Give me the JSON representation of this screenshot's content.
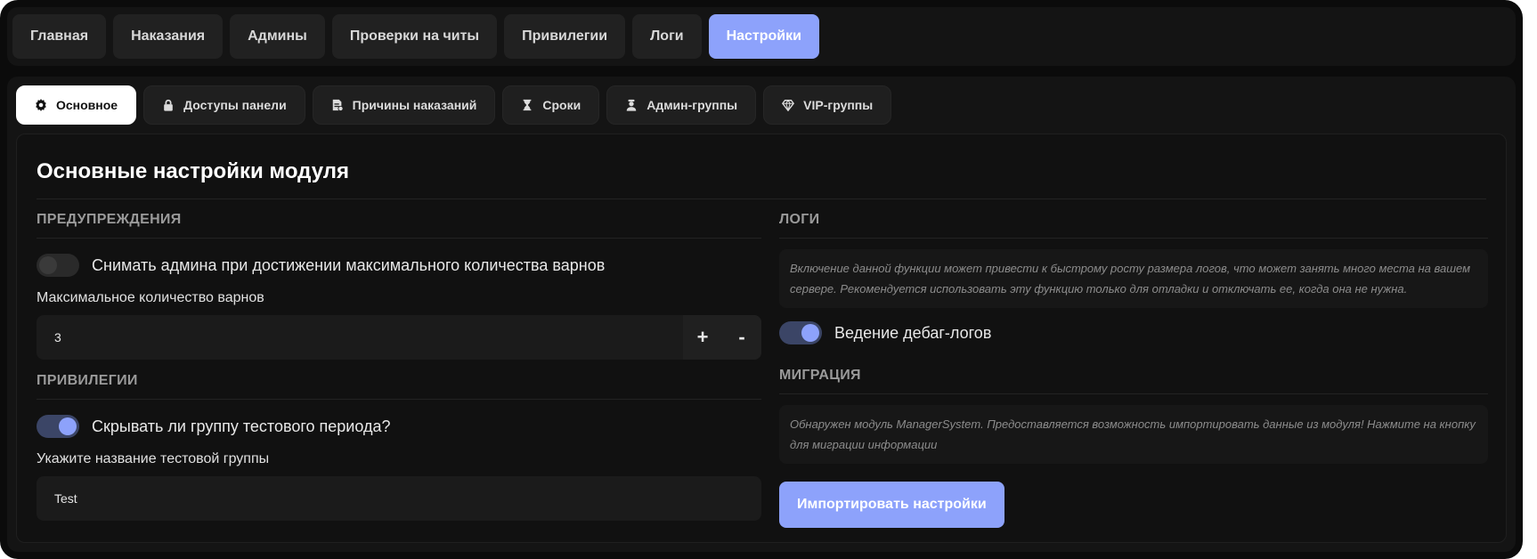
{
  "topnav": {
    "tabs": [
      {
        "label": "Главная"
      },
      {
        "label": "Наказания"
      },
      {
        "label": "Админы"
      },
      {
        "label": "Проверки на читы"
      },
      {
        "label": "Привилегии"
      },
      {
        "label": "Логи"
      },
      {
        "label": "Настройки",
        "active": true
      }
    ]
  },
  "subtabs": [
    {
      "label": "Основное",
      "icon": "gear-icon",
      "active": true
    },
    {
      "label": "Доступы панели",
      "icon": "lock-icon"
    },
    {
      "label": "Причины наказаний",
      "icon": "document-icon"
    },
    {
      "label": "Сроки",
      "icon": "hourglass-icon"
    },
    {
      "label": "Админ-группы",
      "icon": "admin-user-icon"
    },
    {
      "label": "VIP-группы",
      "icon": "diamond-icon"
    }
  ],
  "page": {
    "title": "Основные настройки модуля"
  },
  "warnings": {
    "section": "ПРЕДУПРЕЖДЕНИЯ",
    "toggle_label": "Снимать админа при достижении максимального количества варнов",
    "toggle_on": false,
    "max_label": "Максимальное количество варнов",
    "max_value": "3",
    "plus": "+",
    "minus": "-"
  },
  "privileges": {
    "section": "ПРИВИЛЕГИИ",
    "toggle_label": "Скрывать ли группу тестового периода?",
    "toggle_on": true,
    "group_label": "Укажите название тестовой группы",
    "group_value": "Test"
  },
  "logs": {
    "section": "ЛОГИ",
    "note": "Включение данной функции может привести к быстрому росту размера логов, что может занять много места на вашем сервере. Рекомендуется использовать эту функцию только для отладки и отключать ее, когда она не нужна.",
    "toggle_label": "Ведение дебаг-логов",
    "toggle_on": true
  },
  "migration": {
    "section": "МИГРАЦИЯ",
    "note": "Обнаружен модуль ManagerSystem. Предоставляется возможность импортировать данные из модуля! Нажмите на кнопку для миграции информации",
    "button": "Импортировать настройки"
  },
  "colors": {
    "accent": "#8da2fb",
    "background": "#0b0b0b",
    "panel": "#141414"
  }
}
